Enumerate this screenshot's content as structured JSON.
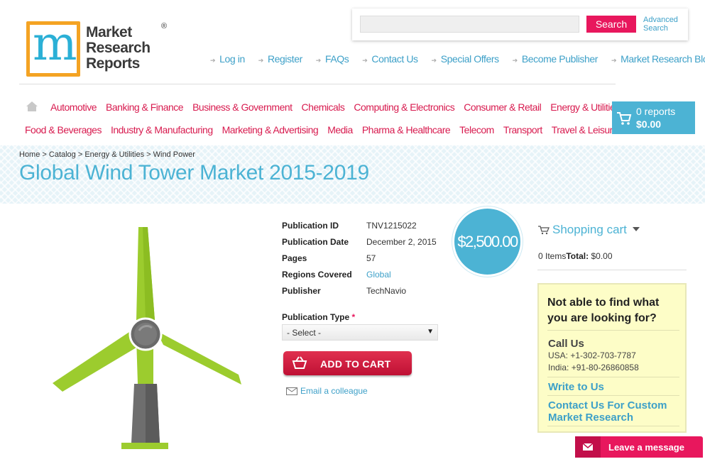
{
  "logo": {
    "line1": "Market",
    "line2": "Research",
    "line3": "Reports",
    "registered": "®"
  },
  "search": {
    "placeholder": "",
    "button": "Search",
    "advanced_line1": "Advanced",
    "advanced_line2": "Search"
  },
  "top_nav": [
    "Log in",
    "Register",
    "FAQs",
    "Contact Us",
    "Special Offers",
    "Become Publisher",
    "Market Research Blog"
  ],
  "categories_row1": [
    "Automotive",
    "Banking & Finance",
    "Business & Government",
    "Chemicals",
    "Computing & Electronics",
    "Consumer & Retail",
    "Energy & Utilities"
  ],
  "categories_row2": [
    "Food & Beverages",
    "Industry & Manufacturing",
    "Marketing & Advertising",
    "Media",
    "Pharma & Healthcare",
    "Telecom",
    "Transport",
    "Travel & Leisure"
  ],
  "cart": {
    "reports": "0 reports",
    "amount": "$0.00"
  },
  "breadcrumb": "Home > Catalog > Energy & Utilities > Wind Power",
  "page_title": "Global Wind Tower Market 2015-2019",
  "details": {
    "pub_id_label": "Publication ID",
    "pub_id": "TNV1215022",
    "pub_date_label": "Publication Date",
    "pub_date": "December 2, 2015",
    "pages_label": "Pages",
    "pages": "57",
    "regions_label": "Regions Covered",
    "regions": "Global",
    "publisher_label": "Publisher",
    "publisher": "TechNavio"
  },
  "price": "$2,500.00",
  "pub_type": {
    "label": "Publication Type",
    "required": "*",
    "selected": "- Select -"
  },
  "add_to_cart": "ADD TO CART",
  "email_colleague": "Email a colleague",
  "shopping_cart": {
    "title": "Shopping cart",
    "items": "0 Items",
    "total_label": "Total:",
    "total": " $0.00"
  },
  "help": {
    "question": "Not able to find what you are looking for?",
    "call_us": "Call Us",
    "phone_usa": "USA: +1-302-703-7787",
    "phone_india": "India: +91-80-26860858",
    "write": "Write to Us",
    "custom": "Contact Us For Custom Market Research"
  },
  "leave_message": "Leave a message",
  "colors": {
    "accent": "#4cb3d4",
    "brand_pink": "#e8175d",
    "category": "#d81b4f",
    "turbine_green": "#9ccc2e"
  }
}
